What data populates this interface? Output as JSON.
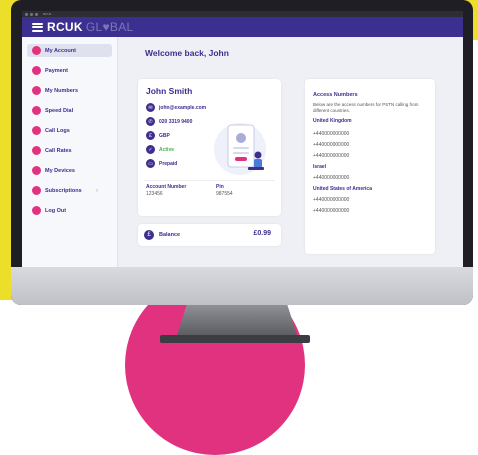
{
  "browser": {
    "tab_title": "RCUK"
  },
  "header": {
    "logo_main": "RCUK",
    "logo_sub": "GL♥BAL"
  },
  "sidebar": {
    "items": [
      {
        "label": "My Account"
      },
      {
        "label": "Payment"
      },
      {
        "label": "My Numbers"
      },
      {
        "label": "Speed Dial"
      },
      {
        "label": "Call Logs"
      },
      {
        "label": "Call Rates"
      },
      {
        "label": "My Devices"
      },
      {
        "label": "Subscriptions",
        "chevron": "›"
      },
      {
        "label": "Log Out"
      }
    ]
  },
  "main": {
    "welcome": "Welcome back, John",
    "profile": {
      "name": "John Smith",
      "email": "john@example.com",
      "phone": "020 3319 9400",
      "currency": "GBP",
      "status": "Active",
      "plan": "Prepaid",
      "account_number_label": "Account Number",
      "account_number": "123456",
      "pin_label": "Pin",
      "pin": "987554"
    },
    "balance": {
      "icon": "£",
      "label": "Balance",
      "value": "£0.99"
    },
    "access": {
      "title": "Access Numbers",
      "description": "Below are the access numbers for PSTN calling from different countries.",
      "lines": [
        {
          "type": "country",
          "text": "United Kingdom"
        },
        {
          "type": "number",
          "text": "+440000000000"
        },
        {
          "type": "number",
          "text": "+440000000000"
        },
        {
          "type": "number",
          "text": "+440000000000"
        },
        {
          "type": "country",
          "text": "Israel"
        },
        {
          "type": "number",
          "text": "+440000000000"
        },
        {
          "type": "country",
          "text": "United States of America"
        },
        {
          "type": "number",
          "text": "+440000000000"
        },
        {
          "type": "number",
          "text": "+440000000000"
        }
      ]
    }
  },
  "colors": {
    "brand": "#3b2f8f",
    "accent": "#e0327e",
    "yellow": "#ecdf2a",
    "active_status": "#4caf50"
  }
}
